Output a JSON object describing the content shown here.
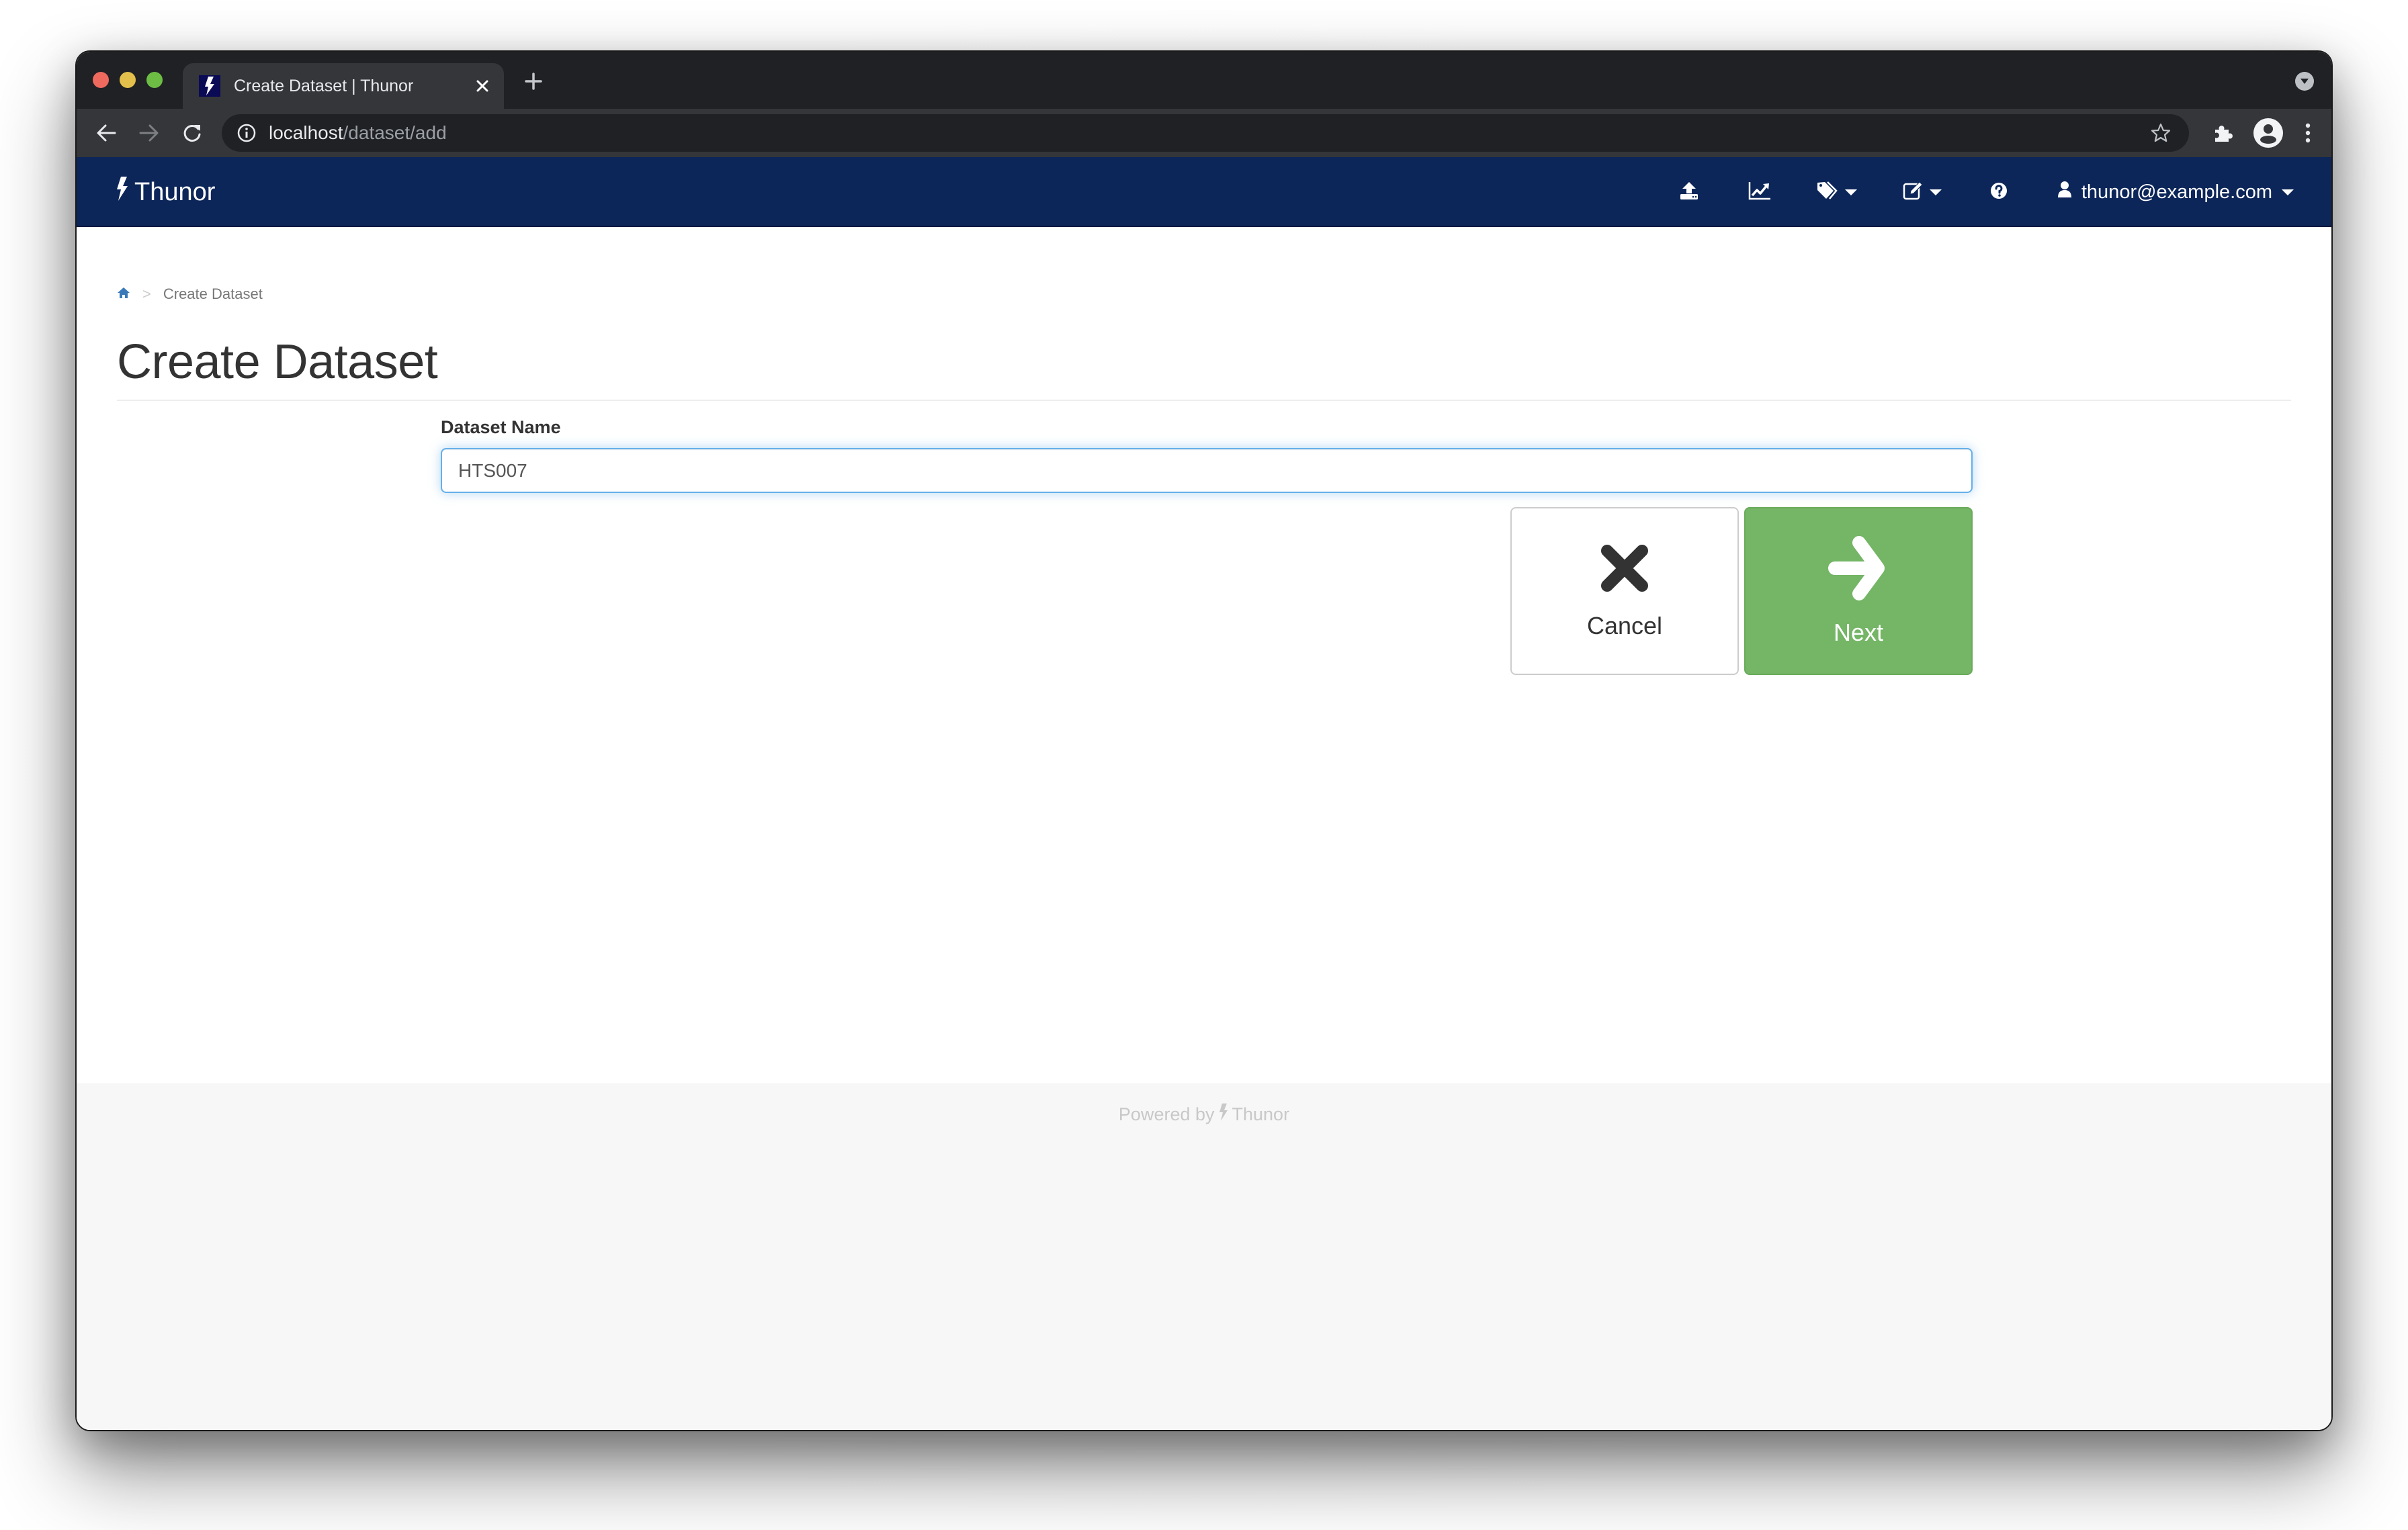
{
  "browser": {
    "tab": {
      "title": "Create Dataset | Thunor",
      "favicon": "bolt-icon"
    },
    "address": {
      "host": "localhost",
      "path": "/dataset/add"
    },
    "icons": {
      "back": "arrow-left-icon",
      "forward": "arrow-right-icon",
      "reload": "reload-icon",
      "site_info": "info-icon",
      "bookmark": "star-icon",
      "extensions": "puzzle-icon",
      "profile": "account-circle-icon",
      "menu": "kebab-menu-icon",
      "new_tab": "plus-icon",
      "tab_close": "close-icon",
      "tab_search": "chevron-down-circle-icon"
    }
  },
  "navbar": {
    "brand": "Thunor",
    "brand_icon": "bolt-icon",
    "items": [
      {
        "icon": "upload-icon",
        "has_dropdown": false
      },
      {
        "icon": "line-chart-icon",
        "has_dropdown": false
      },
      {
        "icon": "tags-icon",
        "has_dropdown": true
      },
      {
        "icon": "edit-icon",
        "has_dropdown": true
      },
      {
        "icon": "help-icon",
        "has_dropdown": false
      }
    ],
    "user": {
      "icon": "user-icon",
      "email": "thunor@example.com"
    },
    "color": "#0c2659"
  },
  "breadcrumb": {
    "home_icon": "home-icon",
    "separator": ">",
    "current": "Create Dataset"
  },
  "page": {
    "title": "Create Dataset",
    "form": {
      "label": "Dataset Name",
      "value": "HTS007"
    },
    "buttons": {
      "cancel": {
        "label": "Cancel",
        "icon": "close-icon"
      },
      "next": {
        "label": "Next",
        "icon": "arrow-right-icon",
        "color": "#74b566"
      }
    }
  },
  "footer": {
    "prefix": "Powered by",
    "brand": "Thunor"
  }
}
